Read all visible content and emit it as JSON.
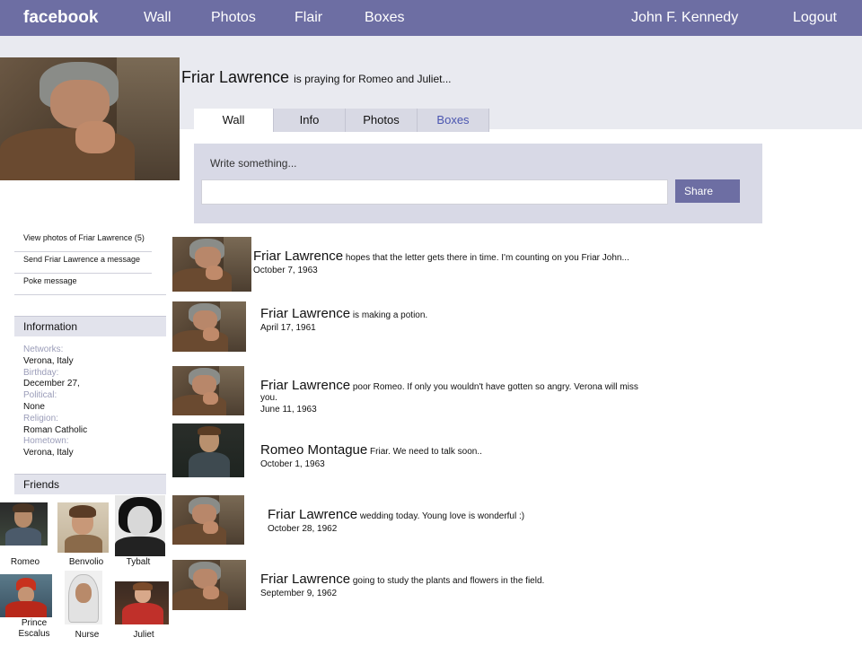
{
  "topbar": {
    "logo": "facebook",
    "nav": [
      "Wall",
      "Photos",
      "Flair",
      "Boxes"
    ],
    "user": "John F. Kennedy",
    "logout": "Logout"
  },
  "profile": {
    "name": "Friar Lawrence",
    "status": "is praying for Romeo and Juliet..."
  },
  "tabs": [
    "Wall",
    "Info",
    "Photos",
    "Boxes"
  ],
  "composer": {
    "prompt": "Write something...",
    "value": "",
    "share": "Share"
  },
  "sidebar": {
    "links": [
      "View photos of Friar Lawrence (5)",
      "Send Friar Lawrence a message",
      "Poke message"
    ],
    "info_title": "Information",
    "info": [
      {
        "k": "Networks:",
        "v": "Verona, Italy"
      },
      {
        "k": "Birthday:",
        "v": "December 27,"
      },
      {
        "k": "Political:",
        "v": "None"
      },
      {
        "k": "Religion:",
        "v": "Roman Catholic"
      },
      {
        "k": "Hometown:",
        "v": "Verona, Italy"
      }
    ],
    "friends_title": "Friends",
    "friends": [
      "Romeo",
      "Benvolio",
      "Tybalt",
      "Prince Escalus",
      "Nurse",
      "Juliet"
    ]
  },
  "posts": [
    {
      "author": "Friar Lawrence",
      "text": "hopes that the letter gets there in time. I'm counting on you Friar John...",
      "date": "October 7, 1963"
    },
    {
      "author": "Friar Lawrence",
      "text": "is making a potion.",
      "date": "April 17, 1961"
    },
    {
      "author": "Friar Lawrence",
      "text": "poor Romeo. If only you wouldn't have gotten so angry. Verona will miss you.",
      "date": "June 11, 1963"
    },
    {
      "author": "Romeo Montague",
      "text": "Friar. We need to talk soon..",
      "date": "October 1, 1963"
    },
    {
      "author": "Friar Lawrence",
      "text": "wedding today. Young love is wonderful :)",
      "date": "October 28, 1962"
    },
    {
      "author": "Friar Lawrence",
      "text": "going to study the plants and flowers in the field.",
      "date": "September 9, 1962"
    }
  ],
  "colors": {
    "topbar": "#6d6ea3",
    "accent": "#4a55b0",
    "panel": "#d8d9e6"
  }
}
